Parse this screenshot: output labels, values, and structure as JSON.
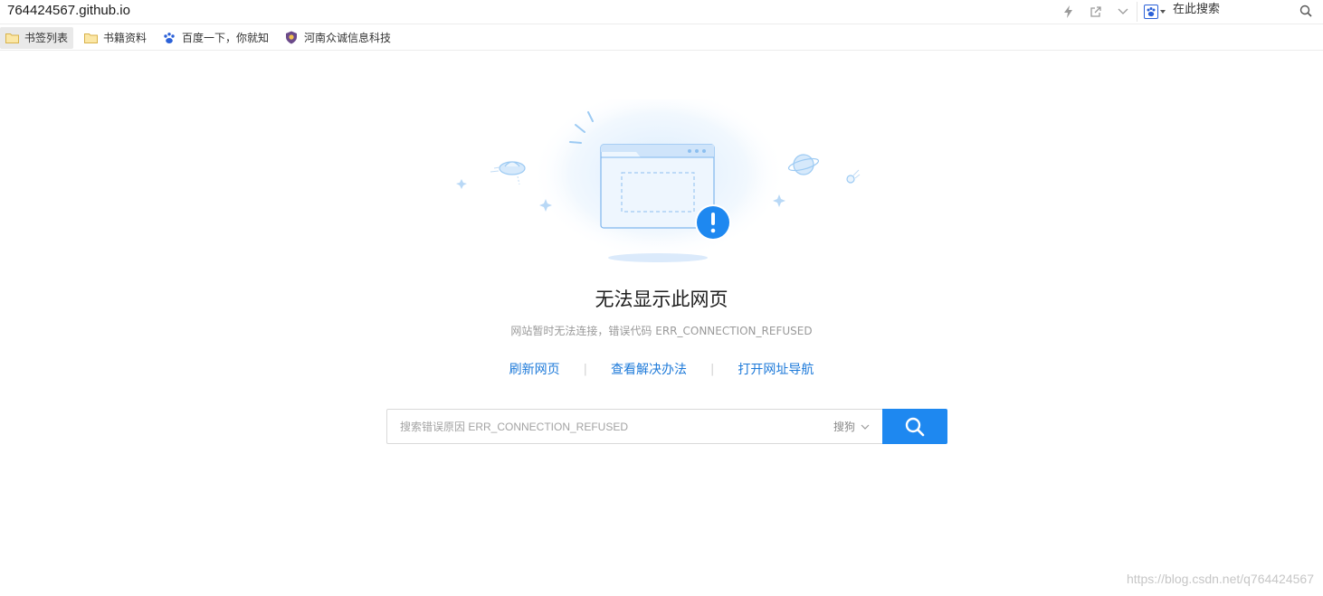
{
  "address_bar": {
    "url": "764424567.github.io",
    "search_placeholder": "在此搜索",
    "icons": [
      "lightning-icon",
      "share-icon",
      "chevron-down-icon",
      "baidu-paw-icon",
      "search-icon"
    ]
  },
  "bookmarks": [
    {
      "label": "书签列表",
      "icon": "folder-icon",
      "active": true
    },
    {
      "label": "书籍资料",
      "icon": "folder-icon",
      "active": false
    },
    {
      "label": "百度一下，你就知",
      "icon": "baidu-paw-icon",
      "active": false
    },
    {
      "label": "河南众诚信息科技",
      "icon": "shield-logo-icon",
      "active": false
    }
  ],
  "error": {
    "title": "无法显示此网页",
    "subtitle": "网站暂时无法连接，错误代码 ERR_CONNECTION_REFUSED",
    "links": [
      {
        "label": "刷新网页"
      },
      {
        "label": "查看解决办法"
      },
      {
        "label": "打开网址导航"
      }
    ],
    "link_divider": "|"
  },
  "search": {
    "placeholder": "搜索错误原因 ERR_CONNECTION_REFUSED",
    "engine": "搜狗",
    "button_icon": "search-icon"
  },
  "watermark": "https://blog.csdn.net/q764424567",
  "colors": {
    "accent": "#1e88f0",
    "link": "#1c79d9",
    "illustration_stroke": "#7fb6ee",
    "illustration_fill": "#eaf4fd"
  }
}
